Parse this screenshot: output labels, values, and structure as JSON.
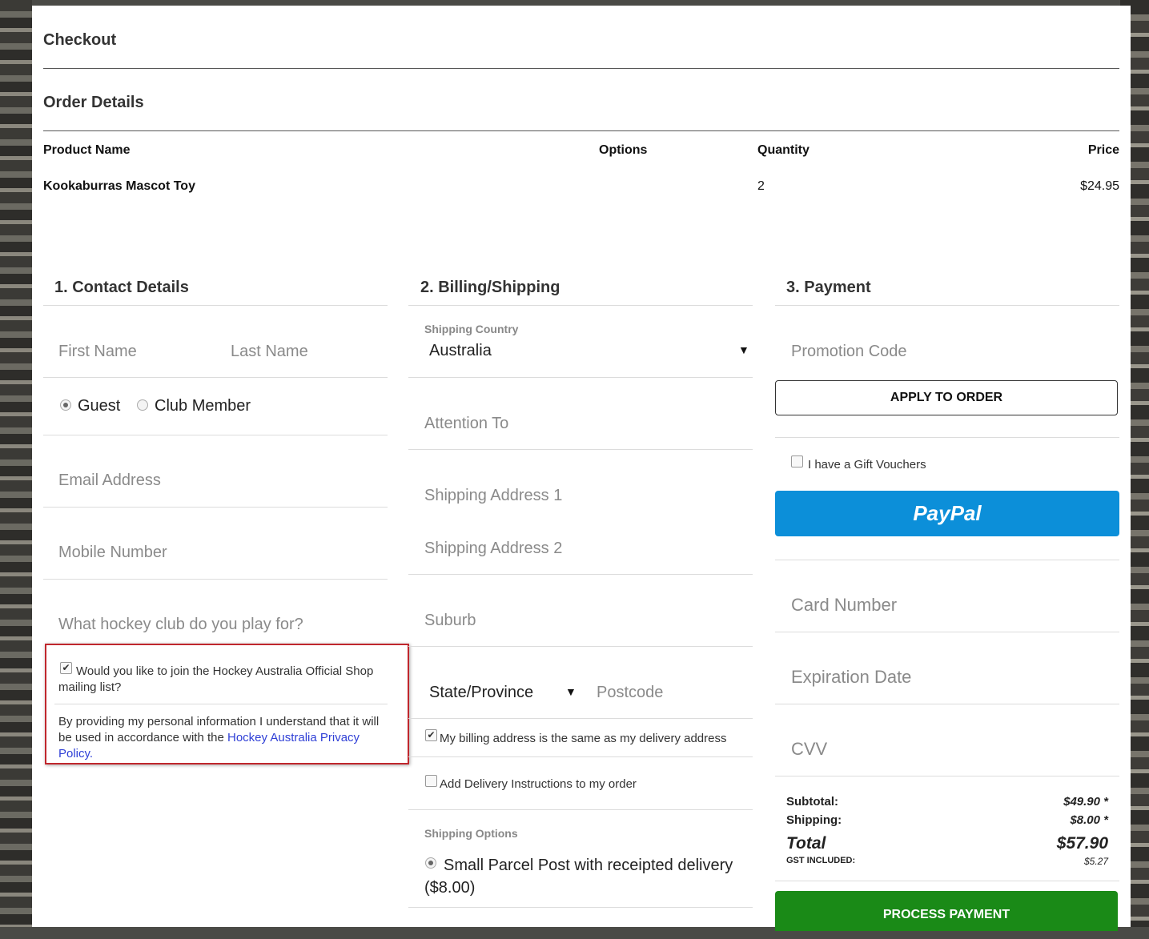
{
  "page": {
    "title": "Checkout",
    "order_details_title": "Order Details"
  },
  "order_table": {
    "headers": [
      "Product Name",
      "Options",
      "Quantity",
      "Price"
    ],
    "rows": [
      {
        "product": "Kookaburras Mascot Toy",
        "options": "",
        "quantity": "2",
        "price": "$24.95"
      }
    ]
  },
  "contact": {
    "title": "1. Contact Details",
    "first_name_placeholder": "First Name",
    "last_name_placeholder": "Last Name",
    "radio_guest": "Guest",
    "radio_club_member": "Club Member",
    "selected": "Guest",
    "email_placeholder": "Email Address",
    "mobile_placeholder": "Mobile Number",
    "club_placeholder": "What hockey club do you play for?",
    "mailing_list_label": "Would you like to join the Hockey Australia Official Shop mailing list?",
    "mailing_list_checked": true,
    "privacy_text": "By providing my personal information I understand that it will be used in accordance with the",
    "privacy_link": "Hockey Australia Privacy Policy",
    "privacy_end": "."
  },
  "billing": {
    "title": "2. Billing/Shipping",
    "country_label": "Shipping Country",
    "country_value": "Australia",
    "attention_placeholder": "Attention To",
    "address1_placeholder": "Shipping Address 1",
    "address2_placeholder": "Shipping Address 2",
    "suburb_placeholder": "Suburb",
    "state_value": "State/Province",
    "postcode_placeholder": "Postcode",
    "same_address_label": "My billing address is the same as my delivery address",
    "same_address_checked": true,
    "delivery_instructions_label": "Add Delivery Instructions to my order",
    "delivery_instructions_checked": false,
    "shipping_options_label": "Shipping Options",
    "shipping_option": "Small Parcel Post with receipted delivery ($8.00)"
  },
  "payment": {
    "title": "3. Payment",
    "promo_placeholder": "Promotion Code",
    "apply_button": "APPLY TO ORDER",
    "gift_voucher_label": "I have a Gift Vouchers",
    "gift_voucher_checked": false,
    "paypal_label": "PayPal",
    "card_placeholder": "Card Number",
    "expiry_placeholder": "Expiration Date",
    "cvv_placeholder": "CVV",
    "subtotal_label": "Subtotal:",
    "subtotal_value": "$49.90 *",
    "shipping_label": "Shipping:",
    "shipping_value": "$8.00 *",
    "total_label": "Total",
    "total_value": "$57.90",
    "gst_label": "GST INCLUDED:",
    "gst_value": "$5.27",
    "process_button": "PROCESS PAYMENT"
  },
  "colors": {
    "paypal_blue": "#0c8fd9",
    "process_green": "#1a8a17",
    "highlight_red": "#c0272d",
    "link_blue": "#2f3fd6"
  }
}
